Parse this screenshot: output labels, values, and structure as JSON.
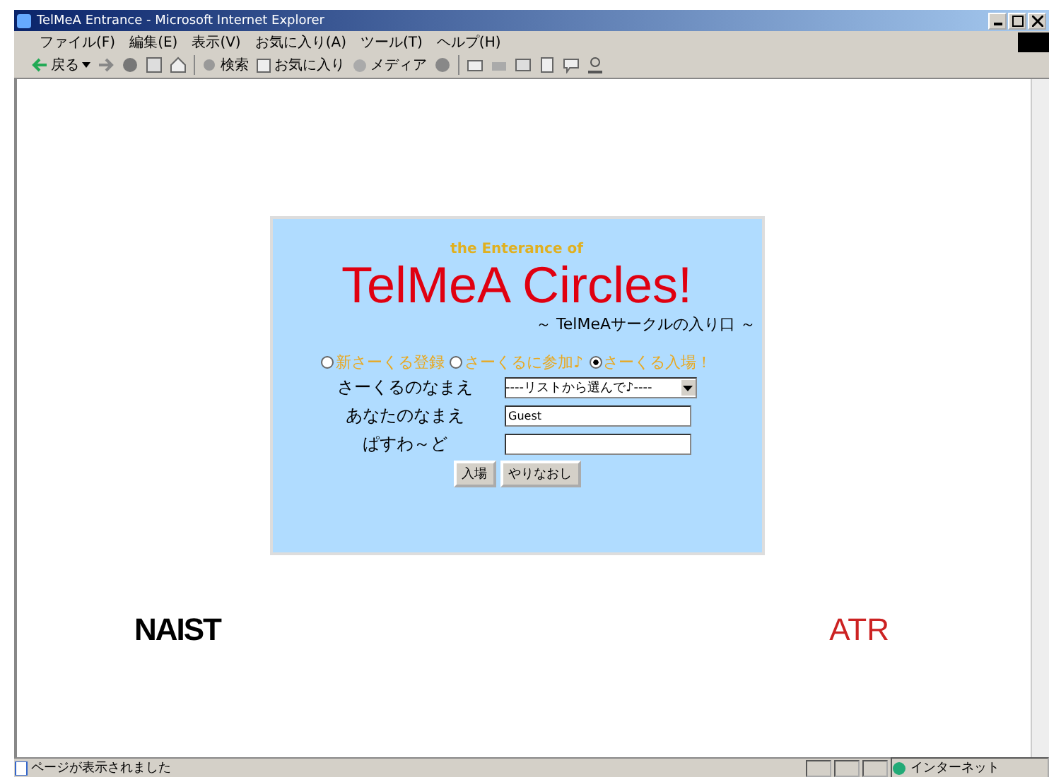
{
  "window": {
    "title": "TelMeA Entrance - Microsoft Internet Explorer"
  },
  "menu": [
    "ファイル(F)",
    "編集(E)",
    "表示(V)",
    "お気に入り(A)",
    "ツール(T)",
    "ヘルプ(H)"
  ],
  "toolbar": {
    "back": "戻る",
    "search": "検索",
    "favorites": "お気に入り",
    "media": "メディア"
  },
  "panel": {
    "subtitle": "the Enterance of",
    "title": "TelMeA Circles!",
    "tagline": "～ TelMeAサークルの入り口 ～",
    "modes": [
      {
        "label": "新さーくる登録",
        "selected": false
      },
      {
        "label": "さーくるに参加♪",
        "selected": false
      },
      {
        "label": "さーくる入場！",
        "selected": true
      }
    ],
    "fields": [
      {
        "kind": "select",
        "label": "さーくるのなまえ",
        "value": "----リストから選んで♪----"
      },
      {
        "kind": "text",
        "label": "あなたのなまえ",
        "value": "Guest"
      },
      {
        "kind": "password",
        "label": "ぱすわ～ど"
      }
    ],
    "buttons": [
      "入場",
      "やりなおし"
    ]
  },
  "logos": {
    "left": "NAIST",
    "right": "ATR"
  },
  "status_bar": {
    "message": "ページが表示されました",
    "zone": "インターネット"
  }
}
